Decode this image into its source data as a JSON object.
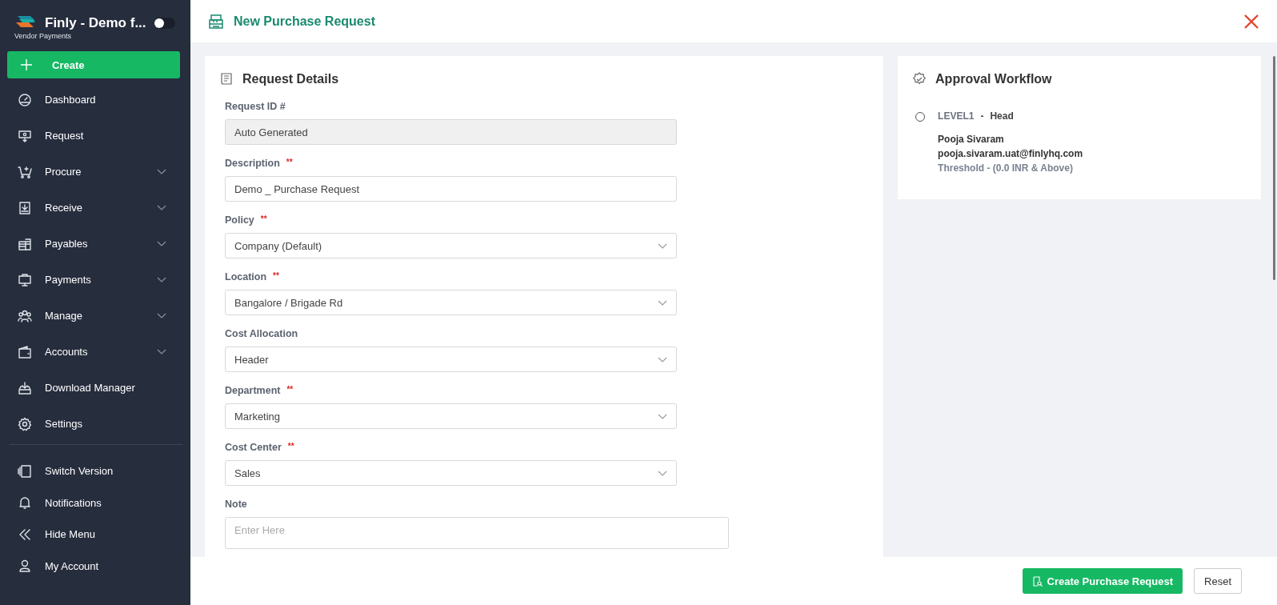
{
  "sidebar": {
    "brand": {
      "title": "Finly - Demo f...",
      "subtitle": "Vendor Payments",
      "toggle_on": false
    },
    "create_button": {
      "label": "Create"
    },
    "items": [
      {
        "label": "Dashboard",
        "expandable": false
      },
      {
        "label": "Request",
        "expandable": false
      },
      {
        "label": "Procure",
        "expandable": true
      },
      {
        "label": "Receive",
        "expandable": true
      },
      {
        "label": "Payables",
        "expandable": true
      },
      {
        "label": "Payments",
        "expandable": true
      },
      {
        "label": "Manage",
        "expandable": true
      },
      {
        "label": "Accounts",
        "expandable": true
      },
      {
        "label": "Download Manager",
        "expandable": false
      },
      {
        "label": "Settings",
        "expandable": false
      }
    ],
    "bottom_items": [
      {
        "label": "Switch Version"
      },
      {
        "label": "Notifications"
      },
      {
        "label": "Hide Menu"
      },
      {
        "label": "My Account"
      }
    ]
  },
  "header": {
    "title": "New Purchase Request"
  },
  "request_details": {
    "title": "Request Details",
    "fields": [
      {
        "label": "Request ID #",
        "kind": "readonly",
        "value": "Auto Generated"
      },
      {
        "label": "Description",
        "required_mark": "**",
        "kind": "text",
        "value": "Demo _ Purchase Request"
      },
      {
        "label": "Policy",
        "required_mark": "**",
        "kind": "select",
        "value": "Company (Default)"
      },
      {
        "label": "Location",
        "required_mark": "**",
        "kind": "select",
        "value": "Bangalore / Brigade Rd"
      },
      {
        "label": "Cost Allocation",
        "kind": "select",
        "value": "Header"
      },
      {
        "label": "Department",
        "required_mark": "**",
        "kind": "select",
        "value": "Marketing"
      },
      {
        "label": "Cost Center",
        "required_mark": "**",
        "kind": "select",
        "value": "Sales"
      },
      {
        "label": "Note",
        "kind": "textarea",
        "placeholder": "Enter Here"
      }
    ]
  },
  "approval_workflow": {
    "title": "Approval Workflow",
    "levels": [
      {
        "level": "LEVEL1",
        "separator": "-",
        "role": "Head",
        "name": "Pooja Sivaram",
        "email": "pooja.sivaram.uat@finlyhq.com",
        "threshold": "Threshold -  (0.0 INR & Above)",
        "done": false
      }
    ]
  },
  "footer": {
    "buttons": [
      {
        "label": "Create Purchase Request",
        "kind": "primary"
      },
      {
        "label": "Reset",
        "kind": "secondary"
      }
    ]
  }
}
